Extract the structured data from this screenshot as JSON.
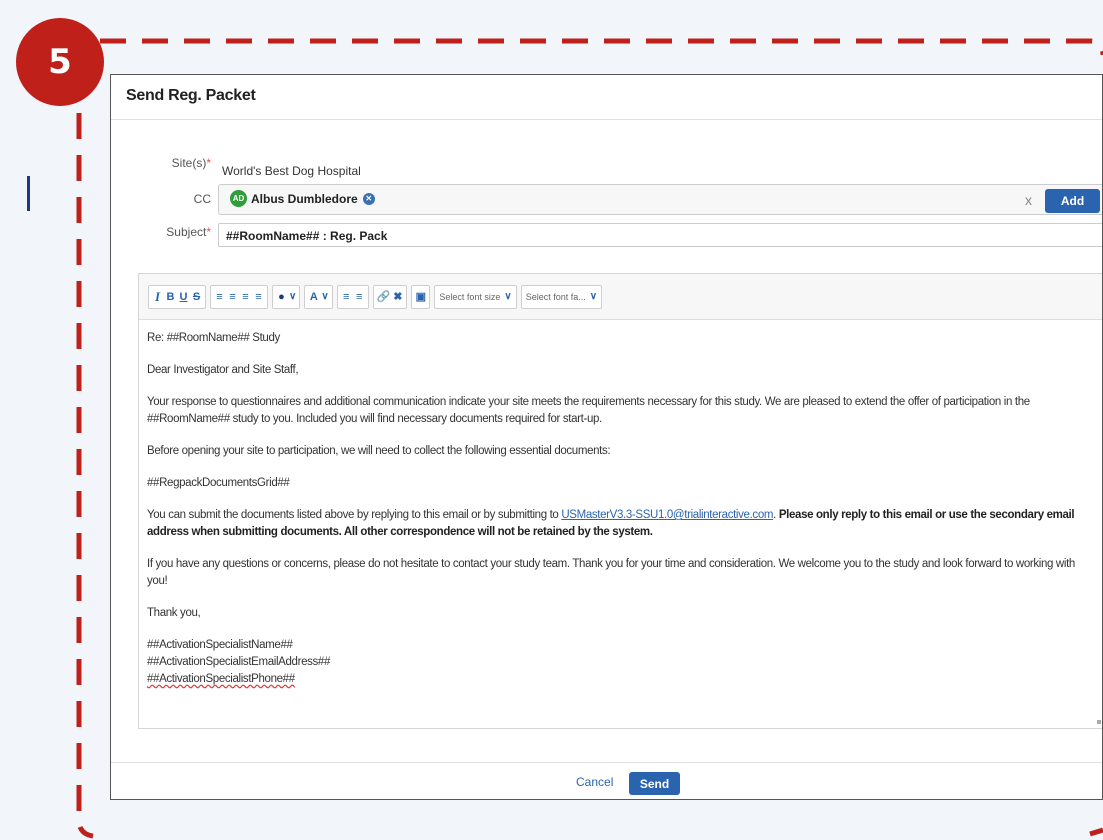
{
  "step": {
    "number": "5"
  },
  "colors": {
    "accent": "#2b64ae",
    "badge": "#c0201a",
    "frame": "#c0201a"
  },
  "dialog": {
    "title": "Send Reg. Packet",
    "site": {
      "label": "Site(s)",
      "required": "*",
      "value": "World's Best Dog Hospital"
    },
    "cc": {
      "label": "CC",
      "chip": {
        "initials": "AD",
        "name": "Albus Dumbledore"
      },
      "clear": "x",
      "add_label": "Add"
    },
    "subject": {
      "label": "Subject",
      "required": "*",
      "value": "##RoomName## : Reg. Pack"
    },
    "toolbar": {
      "italic": "I",
      "bold": "B",
      "underline": "U",
      "strike": "S",
      "font_size_placeholder": "Select font size",
      "font_family_placeholder": "Select font fa..."
    },
    "body": {
      "re_line": "Re: ##RoomName## Study",
      "greeting": "Dear Investigator and Site Staff,",
      "para1": "Your response to questionnaires and additional communication indicate your site meets the requirements necessary for this study. We are pleased to extend the offer of participation in the ##RoomName## study to you. Included you will find necessary documents required for start-up.",
      "para2": "Before opening your site to participation, we will need to collect the following essential documents:",
      "grid_token": "##RegpackDocumentsGrid##",
      "para3_prefix": "You can submit the documents listed above by replying to this email or by submitting to ",
      "para3_email": "USMasterV3.3-SSU1.0@trialinteractive.com",
      "para3_suffix_sep": ". ",
      "para3_bold": "Please only reply to this email or use the secondary email address when submitting documents. All other correspondence will not be retained by the system.",
      "para4": "If you have any questions or concerns, please do not hesitate to contact your study team. Thank you for your time and consideration. We welcome you to the study and look forward to working with you!",
      "thanks": "Thank you,",
      "sig_name": "##ActivationSpecialistName##",
      "sig_email": "##ActivationSpecialistEmailAddress##",
      "sig_phone": "##ActivationSpecialistPhone##"
    },
    "footer": {
      "cancel_label": "Cancel",
      "send_label": "Send"
    }
  }
}
